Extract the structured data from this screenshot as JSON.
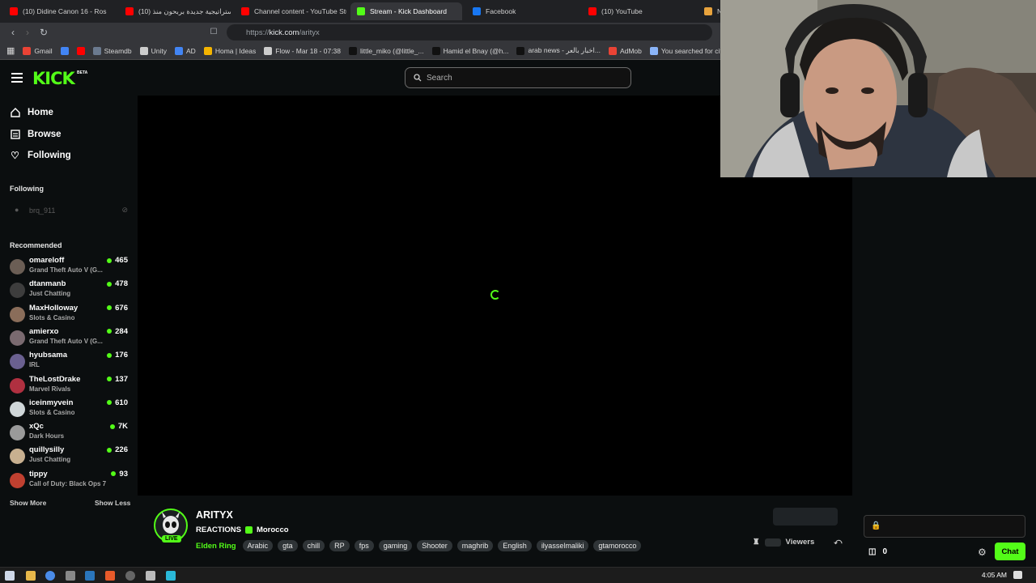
{
  "browser": {
    "tabs": [
      {
        "title": "(10) Didine Canon 16 - Ros",
        "fav_color": "#ff0000"
      },
      {
        "title": "(10) إستراتيجية جديدة بربحون منذ",
        "fav_color": "#ff0000"
      },
      {
        "title": "Channel content - YouTube Stu",
        "fav_color": "#ff0000"
      },
      {
        "title": "Stream - Kick Dashboard",
        "fav_color": "#53fc18"
      },
      {
        "title": "Facebook",
        "fav_color": "#1877f2"
      },
      {
        "title": "(10) YouTube",
        "fav_color": "#ff0000"
      },
      {
        "title": "Ne",
        "fav_color": "#e8a33d"
      }
    ],
    "url_prefix": "https://",
    "url_host": "kick.com",
    "url_path": "/arityx",
    "bookmarks": [
      {
        "label": "Gmail",
        "color": "#ea4335"
      },
      {
        "label": "",
        "color": "#4285f4"
      },
      {
        "label": "",
        "color": "#ff0000"
      },
      {
        "label": "Steamdb",
        "color": "#6b7a8f"
      },
      {
        "label": "Unity",
        "color": "#cccccc"
      },
      {
        "label": "AD",
        "color": "#4285f4"
      },
      {
        "label": "Homa | Ideas",
        "color": "#f4b400"
      },
      {
        "label": "Flow - Mar 18 - 07:38",
        "color": "#cccccc"
      },
      {
        "label": "little_miko (@little_...",
        "color": "#111111"
      },
      {
        "label": "Hamid el Bnay (@h...",
        "color": "#111111"
      },
      {
        "label": "arab news - اخبار بالعر...",
        "color": "#111111"
      },
      {
        "label": "AdMob",
        "color": "#ea4335"
      },
      {
        "label": "You searched for cit...",
        "color": "#8ab4f8"
      }
    ]
  },
  "kick": {
    "logo": "KICK",
    "beta": "BETA",
    "search_placeholder": "Search",
    "nav": [
      {
        "label": "Home",
        "icon": "home-icon"
      },
      {
        "label": "Browse",
        "icon": "browse-icon"
      },
      {
        "label": "Following",
        "icon": "heart-icon"
      }
    ],
    "following_title": "Following",
    "following_user": "brq_911",
    "recommended_title": "Recommended",
    "recommended": [
      {
        "name": "omareloff",
        "category": "Grand Theft Auto V (G...",
        "viewers": "465",
        "color": "#6b5e55"
      },
      {
        "name": "dtanmanb",
        "category": "Just Chatting",
        "viewers": "478",
        "color": "#3d3d3d"
      },
      {
        "name": "MaxHolloway",
        "category": "Slots & Casino",
        "viewers": "676",
        "color": "#8a6d5a"
      },
      {
        "name": "amierxo",
        "category": "Grand Theft Auto V (G...",
        "viewers": "284",
        "color": "#7a6a70"
      },
      {
        "name": "hyubsama",
        "category": "IRL",
        "viewers": "176",
        "color": "#6a6090"
      },
      {
        "name": "TheLostDrake",
        "category": "Marvel Rivals",
        "viewers": "137",
        "color": "#b03040"
      },
      {
        "name": "iceinmyvein",
        "category": "Slots & Casino",
        "viewers": "610",
        "color": "#cfd6d8"
      },
      {
        "name": "xQc",
        "category": "Dark Hours",
        "viewers": "7K",
        "color": "#9a9a9a"
      },
      {
        "name": "quillysilly",
        "category": "Just Chatting",
        "viewers": "226",
        "color": "#c8b090"
      },
      {
        "name": "tippy",
        "category": "Call of Duty: Black Ops 7",
        "viewers": "93",
        "color": "#c04030"
      }
    ],
    "show_more": "Show More",
    "show_less": "Show Less",
    "channel": {
      "name": "ARITYX",
      "title": "REACTIONS",
      "country": "Morocco",
      "live": "LIVE",
      "game": "Elden Ring",
      "tags": [
        "Arabic",
        "gta",
        "chill",
        "RP",
        "fps",
        "gaming",
        "Shooter",
        "maghrib",
        "English",
        "ilyasselmaliki",
        "gtamorocco"
      ],
      "viewers_label": "Viewers"
    },
    "chat": {
      "gift_count": "0",
      "button": "Chat"
    }
  },
  "taskbar": {
    "clock": "4:05 AM"
  },
  "colors": {
    "accent": "#53fc18",
    "background": "#0b0e0f"
  }
}
